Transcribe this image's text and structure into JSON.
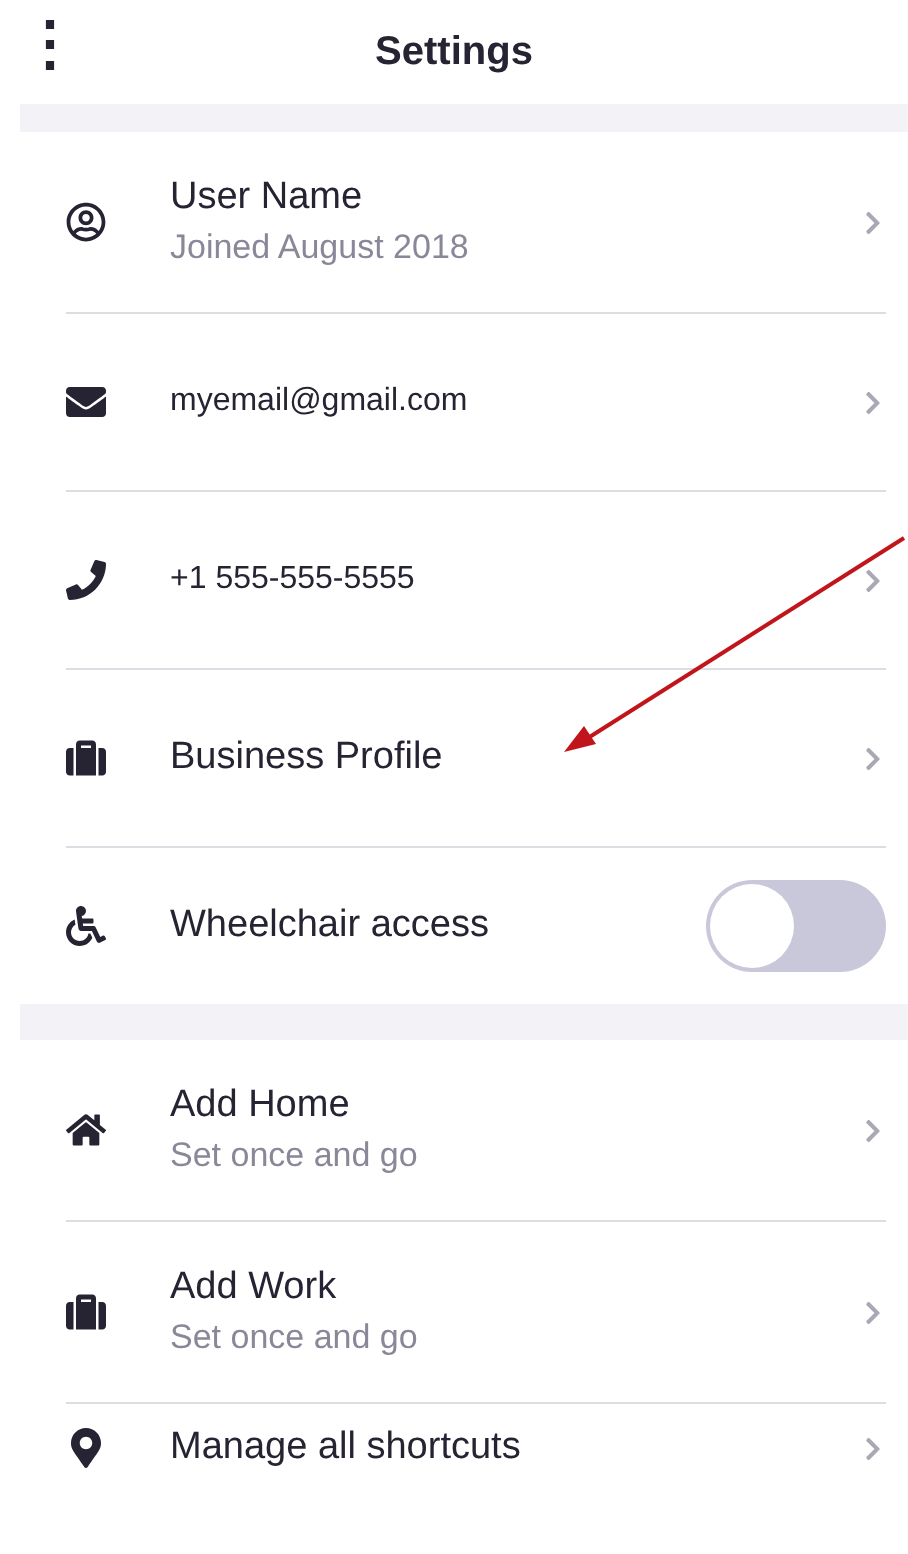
{
  "header": {
    "menu_icon": "⋮",
    "title": "Settings"
  },
  "sections": [
    {
      "items": [
        {
          "kind": "link",
          "title": "User Name",
          "subtitle": "Joined August 2018"
        },
        {
          "kind": "link",
          "title": "myemail@gmail.com"
        },
        {
          "kind": "link",
          "title": "+1 555-555-5555"
        },
        {
          "kind": "link",
          "title": "Business Profile"
        },
        {
          "kind": "toggle",
          "title": "Wheelchair access",
          "on": false
        }
      ]
    },
    {
      "items": [
        {
          "kind": "link",
          "title": "Add Home",
          "subtitle": "Set once and go"
        },
        {
          "kind": "link",
          "title": "Add Work",
          "subtitle": "Set once and go"
        },
        {
          "kind": "link",
          "title": "Manage all shortcuts"
        }
      ]
    }
  ]
}
